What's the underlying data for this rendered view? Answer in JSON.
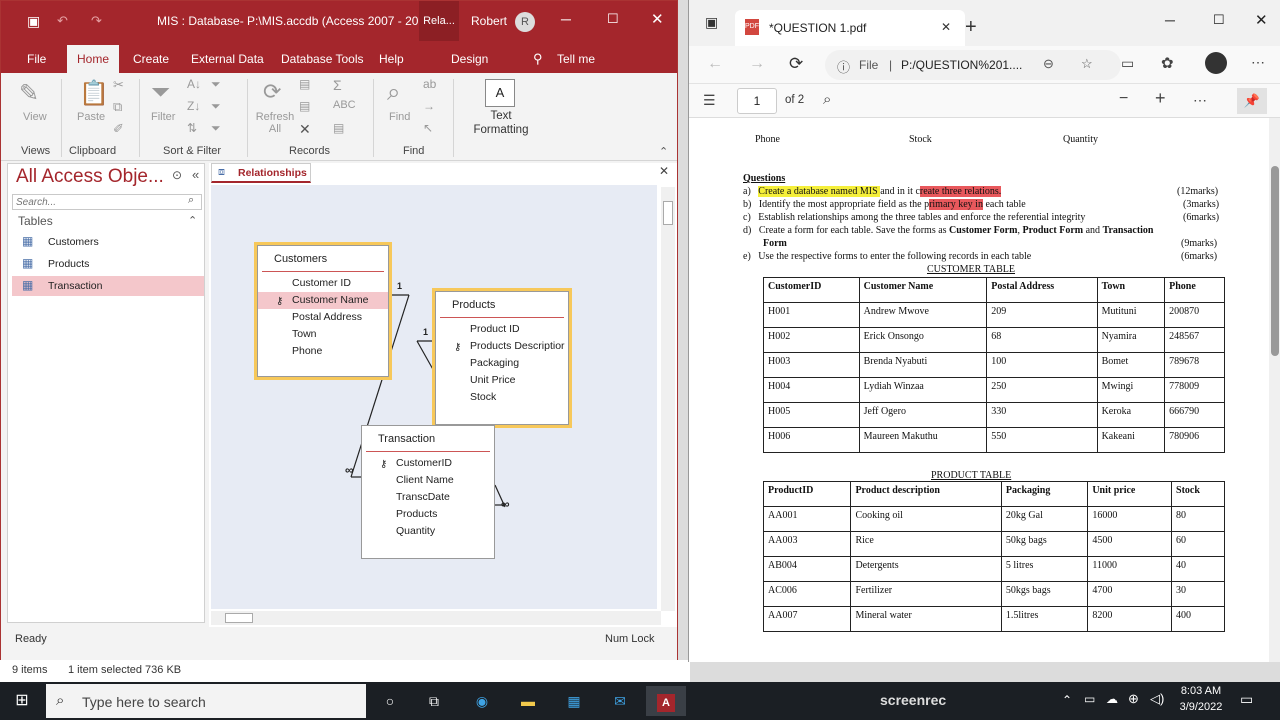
{
  "access": {
    "window_title": "MIS : Database- P:\\MIS.accdb (Access 2007 - 201...",
    "context_tab": "Rela...",
    "user": "Robert",
    "user_initial": "R",
    "tabs": [
      "File",
      "Home",
      "Create",
      "External Data",
      "Database Tools",
      "Help",
      "Design"
    ],
    "tell_me": "Tell me",
    "ribbon": {
      "view": "View",
      "paste": "Paste",
      "filter": "Filter",
      "refresh": "Refresh All",
      "find": "Find",
      "text_formatting": "Text Formatting",
      "text_icon": "A",
      "groups": [
        "Views",
        "Clipboard",
        "Sort & Filter",
        "Records",
        "Find"
      ]
    },
    "nav": {
      "title": "All Access Obje...",
      "search_placeholder": "Search...",
      "section": "Tables",
      "items": [
        "Customers",
        "Products",
        "Transaction"
      ]
    },
    "rel_tab": "Relationships",
    "tables": {
      "customers": {
        "title": "Customers",
        "fields": [
          "Customer ID",
          "Customer Name",
          "Postal Address",
          "Town",
          "Phone"
        ]
      },
      "products": {
        "title": "Products",
        "fields": [
          "Product ID",
          "Products Descriptior",
          "Packaging",
          "Unit Price",
          "Stock"
        ]
      },
      "transaction": {
        "title": "Transaction",
        "fields": [
          "CustomerID",
          "Client Name",
          "TranscDate",
          "Products",
          "Quantity"
        ]
      }
    },
    "rel_labels": {
      "one_a": "1",
      "one_b": "1",
      "many_a": "∞",
      "many_b": "∞"
    },
    "status_left": "Ready",
    "status_right": "Num Lock",
    "explorer": {
      "items": "9 items",
      "selected": "1 item selected  736 KB"
    }
  },
  "pdf": {
    "tab_title": "*QUESTION 1.pdf",
    "address_label": "File",
    "address": "P:/QUESTION%201....",
    "page_current": "1",
    "page_total": "of 2",
    "top_headers": [
      "Phone",
      "Stock",
      "Quantity"
    ],
    "questions_heading": "Questions",
    "questions": [
      {
        "label": "a)",
        "text_hl1": "Create a database named MIS ",
        "text_mid": "and in it c",
        "text_hl2": "reate three relations.",
        "marks": "(12marks)"
      },
      {
        "label": "b)",
        "text_a": "Identify the most appropriate field as the p",
        "text_hl": "rimary key in",
        "text_b": " each table",
        "marks": "(3marks)"
      },
      {
        "label": "c)",
        "text": "Establish relationships among the three tables and enforce the referential integrity",
        "marks": "(6marks)"
      },
      {
        "label": "d)",
        "text_a": "Create a form for each table. Save the forms as ",
        "b1": "Customer Form",
        "sep1": ", ",
        "b2": "Product Form",
        "sep2": " and ",
        "b3": "Transaction",
        "cont": "Form",
        "marks": "(9marks)"
      },
      {
        "label": "e)",
        "text": "Use the respective forms to enter the following records in each table",
        "marks": "(6marks)"
      }
    ],
    "customer_table": {
      "caption": "CUSTOMER TABLE",
      "headers": [
        "CustomerID",
        "Customer Name",
        "Postal Address",
        "Town",
        "Phone"
      ],
      "rows": [
        [
          "H001",
          "Andrew Mwove",
          "209",
          "Mutituni",
          "200870"
        ],
        [
          "H002",
          "Erick Onsongo",
          "68",
          "Nyamira",
          "248567"
        ],
        [
          "H003",
          "Brenda Nyabuti",
          "100",
          "Bomet",
          "789678"
        ],
        [
          "H004",
          "Lydiah Winzaa",
          "250",
          "Mwingi",
          "778009"
        ],
        [
          "H005",
          "Jeff Ogero",
          "330",
          "Keroka",
          "666790"
        ],
        [
          "H006",
          "Maureen Makuthu",
          "550",
          "Kakeani",
          "780906"
        ]
      ]
    },
    "product_table": {
      "caption": "PRODUCT TABLE",
      "headers": [
        "ProductID",
        "Product description",
        "Packaging",
        "Unit price",
        "Stock"
      ],
      "rows": [
        [
          "AA001",
          "Cooking oil",
          "20kg Gal",
          "16000",
          "80"
        ],
        [
          "AA003",
          "Rice",
          "50kg bags",
          "4500",
          "60"
        ],
        [
          "AB004",
          "Detergents",
          "5 litres",
          "11000",
          "40"
        ],
        [
          "AC006",
          "Fertilizer",
          "50kgs bags",
          "4700",
          "30"
        ],
        [
          "AA007",
          "Mineral water",
          "1.5litres",
          "8200",
          "400"
        ]
      ]
    }
  },
  "taskbar": {
    "search_placeholder": "Type here to search",
    "time": "8:03 AM",
    "date": "3/9/2022",
    "watermark": "screenrec"
  }
}
